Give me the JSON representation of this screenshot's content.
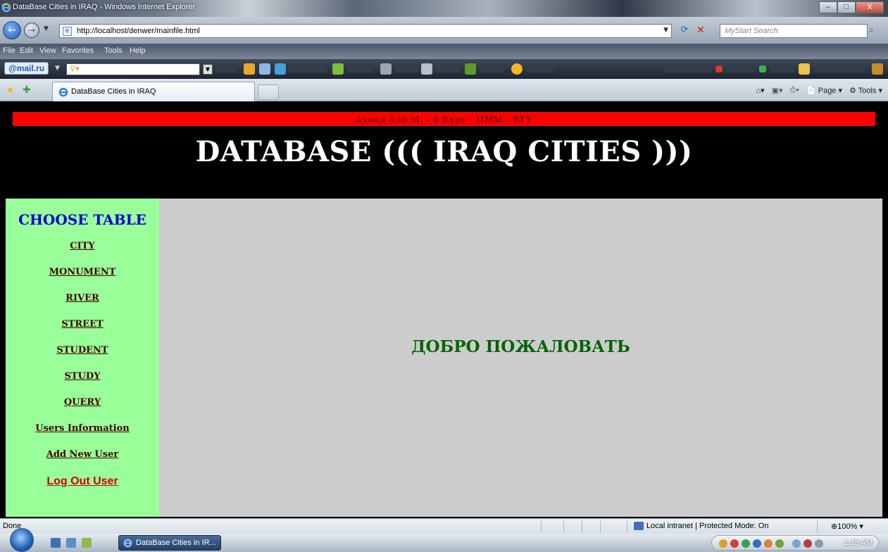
{
  "window": {
    "title": "DataBase Cities in IRAQ - Windows Internet Explorer",
    "buttons": [
      "–",
      "□",
      "X"
    ]
  },
  "address": {
    "url": "http://localhost/denwer/mainfile.html",
    "search_placeholder": "MyStart Search"
  },
  "menu": [
    "File",
    "Edit",
    "View",
    "Favorites",
    "Tools",
    "Help"
  ],
  "mail_toolbar": {
    "brand": "@mail.ru"
  },
  "tabs": {
    "active_label": "DataBase Cities in IRAQ",
    "commands": {
      "page": "Page",
      "tools": "Tools"
    }
  },
  "page": {
    "author_line": "Ахмед Али М. – 6 Курс – ПММ – ВГУ",
    "banner": "DATABASE ((( IRAQ CITIES )))",
    "sidebar": {
      "heading": "CHOOSE TABLE",
      "links": [
        "CITY",
        "MONUMENT",
        "RIVER",
        "STREET",
        "STUDENT",
        "STUDY",
        "QUERY",
        "Users Information",
        "Add New User"
      ],
      "logout": "Log Out User"
    },
    "welcome": "ДОБРО ПОЖАЛОВАТЬ"
  },
  "statusbar": {
    "status": "Done",
    "zone": "Local intranet | Protected Mode: On",
    "zoom": "100%"
  },
  "taskbar": {
    "task_label": "DataBase Cities in IR...",
    "clock": "1:18 AM"
  },
  "colors": {
    "page_bg": "#000000",
    "author_bar": "#ff0000",
    "sidebar_bg": "#99ff99",
    "main_bg": "#cccccc",
    "heading_blue": "#0000cc",
    "welcome_green": "#006400",
    "logout_red": "#cc0000"
  }
}
